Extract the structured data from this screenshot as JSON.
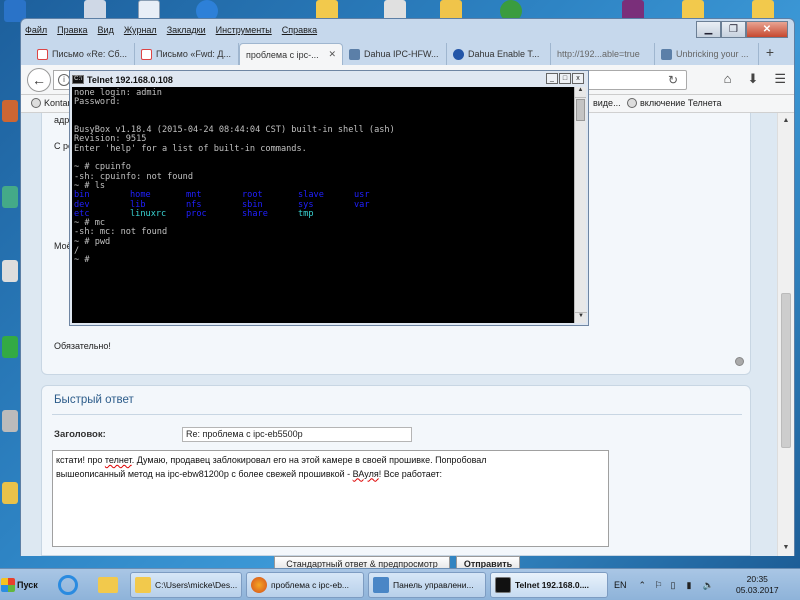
{
  "browser": {
    "menu": [
      "Файл",
      "Правка",
      "Вид",
      "Журнал",
      "Закладки",
      "Инструменты",
      "Справка"
    ],
    "tabs": [
      {
        "label": "Письмо «Re: Сб...",
        "icon": "gmail-icon"
      },
      {
        "label": "Письмо «Fwd: Д...",
        "icon": "gmail-icon"
      },
      {
        "label": "проблема с ipc-...",
        "icon": "forum-icon",
        "active": true
      },
      {
        "label": "Dahua IPC-HFW...",
        "icon": "page-icon"
      },
      {
        "label": "Dahua Enable T...",
        "icon": "page-icon"
      },
      {
        "label": "http://192...able=true",
        "icon": "page-icon"
      },
      {
        "label": "Unbricking your ...",
        "icon": "page-icon"
      }
    ],
    "bookmarks": [
      {
        "label": "Kontar"
      },
      {
        "label": "виде..."
      },
      {
        "label": "включение Телнета"
      }
    ]
  },
  "post": {
    "line_addr": "адр",
    "line_ser": "С ре",
    "line_moe": "Моё",
    "required": "Обязательно!"
  },
  "quick_reply": {
    "title": "Быстрый ответ",
    "subject_label": "Заголовок:",
    "subject_value": "Re: проблема с ipc-eb5500p",
    "body_line1_a": "кстати! про ",
    "body_line1_b": "телнет",
    "body_line1_c": ". Думаю, продавец заблокировал его на этой камере в своей прошивке. Попробовал",
    "body_line2_a": "вышеописанный метод на ipc-ebw81200p с более свежей прошивкой - ",
    "body_line2_b": "ВАуля",
    "body_line2_c": "! Все работает:",
    "btn_preview": "Стандартный ответ & предпросмотр",
    "btn_send": "Отправить"
  },
  "telnet": {
    "title": "Telnet 192.168.0.108",
    "lines": [
      "none login: admin",
      "Password:",
      "",
      "",
      "BusyBox v1.18.4 (2015-04-24 08:44:04 CST) built-in shell (ash)",
      "Revision: 9515",
      "Enter 'help' for a list of built-in commands.",
      "",
      "~ # cpuinfo",
      "-sh: cpuinfo: not found",
      "~ # ls"
    ],
    "ls_rows": [
      [
        "bin",
        "home",
        "mnt",
        "root",
        "slave",
        "usr"
      ],
      [
        "dev",
        "lib",
        "nfs",
        "sbin",
        "sys",
        "var"
      ],
      [
        "etc",
        "linuxrc",
        "proc",
        "share",
        "tmp",
        ""
      ]
    ],
    "lines_after": [
      "~ # mc",
      "-sh: mc: not found",
      "~ # pwd",
      "/",
      "~ #"
    ]
  },
  "taskbar": {
    "start": "Пуск",
    "tasks": [
      {
        "label": "C:\\Users\\micke\\Des..."
      },
      {
        "label": "проблема с ipc-eb..."
      },
      {
        "label": "Панель управлени..."
      },
      {
        "label": "Telnet 192.168.0...."
      }
    ],
    "lang": "EN",
    "time": "20:35",
    "date": "05.03.2017"
  },
  "colors": {
    "ls_dir": "#2020ff",
    "ls_file": "#3ad3d3",
    "heading": "#2c5c8a"
  }
}
